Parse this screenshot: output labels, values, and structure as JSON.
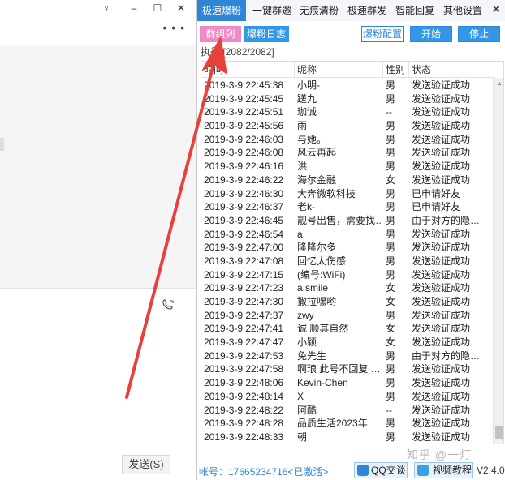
{
  "left_pane": {
    "window_buttons": [
      "♀",
      "–",
      "☐",
      "✕"
    ],
    "more": "• • •",
    "send_label": "发送(S)"
  },
  "tabs": [
    {
      "label": "极速爆粉",
      "active": true
    },
    {
      "label": "一键群邀",
      "active": false
    },
    {
      "label": "无痕清粉",
      "active": false
    },
    {
      "label": "极速群发",
      "active": false
    },
    {
      "label": "智能回复",
      "active": false
    },
    {
      "label": "其他设置",
      "active": false
    }
  ],
  "subtabs": {
    "group_list": "群组列表",
    "log": "爆粉日志"
  },
  "buttons": {
    "config": "爆粉配置",
    "start": "开始",
    "stop": "停止"
  },
  "progress_text": "执行:[2082/2082]",
  "table": {
    "headers": [
      "时间",
      "昵称",
      "性别",
      "状态"
    ],
    "rows": [
      [
        "2019-3-9 22:45:38",
        "小明-",
        "男",
        "发送验证成功"
      ],
      [
        "2019-3-9 22:45:45",
        "蹉九",
        "男",
        "发送验证成功"
      ],
      [
        "2019-3-9 22:45:51",
        "珈诚",
        "--",
        "发送验证成功"
      ],
      [
        "2019-3-9 22:45:56",
        "雨",
        "男",
        "发送验证成功"
      ],
      [
        "2019-3-9 22:46:03",
        "与她。",
        "男",
        "发送验证成功"
      ],
      [
        "2019-3-9 22:46:08",
        "风云再起",
        "男",
        "发送验证成功"
      ],
      [
        "2019-3-9 22:46:16",
        "洪",
        "男",
        "发送验证成功"
      ],
      [
        "2019-3-9 22:46:22",
        "海尔金融",
        "女",
        "发送验证成功"
      ],
      [
        "2019-3-9 22:46:30",
        "大奔微软科技",
        "男",
        "已申请好友"
      ],
      [
        "2019-3-9 22:46:37",
        "老k-",
        "男",
        "已申请好友"
      ],
      [
        "2019-3-9 22:46:45",
        "靓号出售，需要找…",
        "男",
        "由于对方的隐…"
      ],
      [
        "2019-3-9 22:46:54",
        "a",
        "男",
        "发送验证成功"
      ],
      [
        "2019-3-9 22:47:00",
        "隆隆尔多",
        "男",
        "发送验证成功"
      ],
      [
        "2019-3-9 22:47:08",
        "回忆太伤感",
        "男",
        "发送验证成功"
      ],
      [
        "2019-3-9 22:47:15",
        "(编号:WiFi)",
        "男",
        "发送验证成功"
      ],
      [
        "2019-3-9 22:47:23",
        "a.smile",
        "女",
        "发送验证成功"
      ],
      [
        "2019-3-9 22:47:30",
        "  撒拉嘿哟",
        "女",
        "发送验证成功"
      ],
      [
        "2019-3-9 22:47:37",
        "zwy",
        "男",
        "发送验证成功"
      ],
      [
        "2019-3-9 22:47:41",
        "诚 顺其自然",
        "女",
        "发送验证成功"
      ],
      [
        "2019-3-9 22:47:47",
        "小颖",
        "女",
        "发送验证成功"
      ],
      [
        "2019-3-9 22:47:53",
        "免先生",
        "男",
        "由于对方的隐…"
      ],
      [
        "2019-3-9 22:47:58",
        "啊琅 此号不回复 …",
        "男",
        "发送验证成功"
      ],
      [
        "2019-3-9 22:48:06",
        "  Kevin-Chen",
        "男",
        "发送验证成功"
      ],
      [
        "2019-3-9 22:48:14",
        "X",
        "男",
        "发送验证成功"
      ],
      [
        "2019-3-9 22:48:22",
        "阿酷",
        "--",
        "发送验证成功"
      ],
      [
        "2019-3-9 22:48:28",
        "品质生活2023年",
        "男",
        "发送验证成功"
      ],
      [
        "2019-3-9 22:48:33",
        "朝",
        "男",
        "发送验证成功"
      ]
    ]
  },
  "status": {
    "account": "帐号：17665234716<已激活>",
    "qq_label": "QQ交谈",
    "video_label": "视频教程",
    "version": "V2.4.0"
  },
  "watermark": "知乎 @一灯",
  "colors": {
    "accent": "#2f86d6",
    "pink": "#f08ac6",
    "arrow": "#e8413c"
  }
}
